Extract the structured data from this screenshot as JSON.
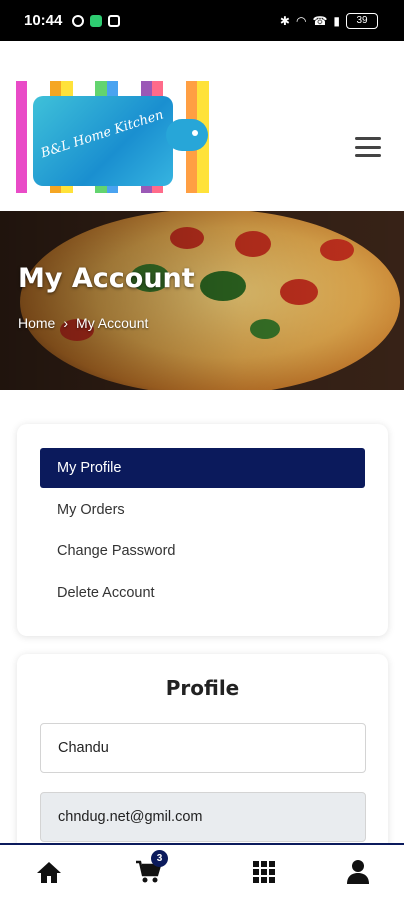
{
  "status_bar": {
    "time": "10:44",
    "battery": "39"
  },
  "header": {
    "logo_text": "B&L Home Kitchen",
    "logo_stripe_colors": [
      "#e94bc7",
      "#f5a623",
      "#ffe23a",
      "#63d46f",
      "#4aa3f0",
      "#9b59b6",
      "#ff6b8a",
      "#ff9f43",
      "#ffe23a"
    ],
    "menu_icon": "hamburger-menu-icon"
  },
  "hero": {
    "title": "My Account",
    "breadcrumb": {
      "home": "Home",
      "separator": "›",
      "current": "My Account"
    }
  },
  "account_menu": {
    "items": [
      {
        "label": "My Profile",
        "active": true
      },
      {
        "label": "My Orders",
        "active": false
      },
      {
        "label": "Change Password",
        "active": false
      },
      {
        "label": "Delete Account",
        "active": false
      }
    ]
  },
  "profile": {
    "title": "Profile",
    "name_value": "Chandu",
    "email_value": "chndug.net@gmil.com"
  },
  "bottom_nav": {
    "items": [
      "home-icon",
      "cart-icon",
      "grid-icon",
      "user-icon"
    ],
    "cart_count": "3"
  },
  "colors": {
    "accent": "#0b1a5c",
    "active_item_text": "#ffffff"
  }
}
